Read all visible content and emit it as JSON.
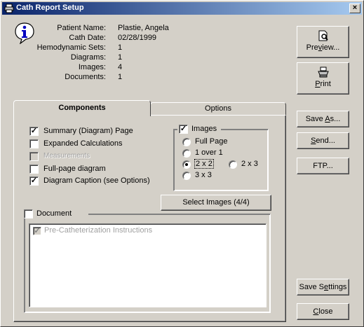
{
  "window": {
    "title": "Cath Report Setup",
    "close_glyph": "×"
  },
  "info": {
    "icon": "info-icon",
    "rows": [
      {
        "label": "Patient Name:",
        "value": "Plastie, Angela"
      },
      {
        "label": "Cath Date:",
        "value": "02/28/1999"
      },
      {
        "label": "Hemodynamic Sets:",
        "value": "1"
      },
      {
        "label": "Diagrams:",
        "value": "1"
      },
      {
        "label": "Images:",
        "value": "4"
      },
      {
        "label": "Documents:",
        "value": "1"
      }
    ]
  },
  "buttons": {
    "preview": {
      "pre": "Pre",
      "u": "v",
      "post": "iew..."
    },
    "print": {
      "pre": "",
      "u": "P",
      "post": "rint"
    },
    "save_as": {
      "pre": "Save ",
      "u": "A",
      "post": "s..."
    },
    "send": {
      "pre": "",
      "u": "S",
      "post": "end..."
    },
    "ftp": {
      "pre": "FTP...",
      "u": "",
      "post": ""
    },
    "save_settings": {
      "pre": "Save S",
      "u": "e",
      "post": "ttings"
    },
    "close": {
      "pre": "",
      "u": "C",
      "post": "lose"
    }
  },
  "tabs": {
    "components": "Components",
    "options": "Options"
  },
  "components": {
    "checks": [
      {
        "label": "Summary (Diagram) Page",
        "checked": true,
        "disabled": false
      },
      {
        "label": "Expanded Calculations",
        "checked": false,
        "disabled": false
      },
      {
        "label": "Measurements",
        "checked": false,
        "disabled": true
      },
      {
        "label": "Full-page diagram",
        "checked": false,
        "disabled": false
      },
      {
        "label": "Diagram Caption (see Options)",
        "checked": true,
        "disabled": false
      }
    ],
    "images_group": {
      "label": "Images",
      "checked": true,
      "radios": [
        {
          "label": "Full Page",
          "selected": false
        },
        {
          "label": "1 over 1",
          "selected": false
        },
        {
          "label": "2 x 2",
          "selected": true
        },
        {
          "label": "2 x 3",
          "selected": false
        },
        {
          "label": "3 x 3",
          "selected": false
        }
      ],
      "select_button": "Select Images (4/4)"
    },
    "document_group": {
      "label": "Document",
      "checked": false,
      "items": [
        {
          "label": "Pre-Catheterization Instructions",
          "checked": true,
          "disabled": true
        }
      ]
    }
  },
  "check_glyph": "✓"
}
